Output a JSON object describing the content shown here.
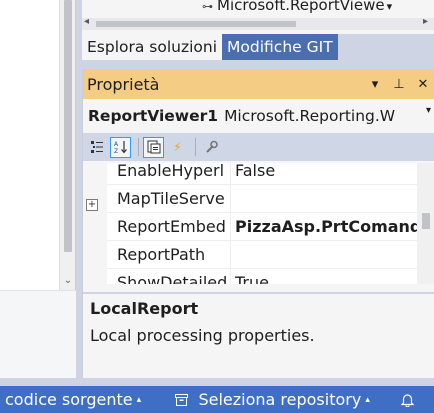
{
  "solution_explorer": {
    "tree_item_label": "Microsoft.ReportViewe",
    "tree_item_icon": "reference-node-icon",
    "tree_item_chevron": "▾"
  },
  "tabs": [
    {
      "label": "Esplora soluzioni",
      "active": true
    },
    {
      "label": "Modifiche GIT",
      "active": false
    }
  ],
  "properties": {
    "title": "Proprietà",
    "buttons": {
      "dropdown": "▾",
      "pin": "⊥",
      "close": "✕"
    },
    "object": {
      "name": "ReportViewer1",
      "type": "Microsoft.Reporting.W"
    },
    "toolbar": [
      "categorized-icon",
      "alphabetical-icon",
      "properties-icon",
      "events-icon",
      "property-pages-icon"
    ],
    "rows": [
      {
        "name": "EnableHyperl",
        "value": "False",
        "bold": false,
        "expandable": false
      },
      {
        "name": "MapTileServe",
        "value": "",
        "bold": false,
        "expandable": true,
        "expander": "+"
      },
      {
        "name": "ReportEmbed",
        "value": "PizzaAsp.PrtComande.rdlc",
        "bold": true,
        "expandable": false
      },
      {
        "name": "ReportPath",
        "value": "",
        "bold": false,
        "expandable": false
      },
      {
        "name": "ShowDetailed",
        "value": "True",
        "bold": false,
        "expandable": false
      }
    ],
    "description": {
      "title": "LocalReport",
      "text": "Local processing properties."
    }
  },
  "statusbar": {
    "source_label": "codice sorgente",
    "repo_label": "Seleziona repository",
    "caret": "▴",
    "repo_icon": "repository-icon",
    "bell_icon": "notification-bell-icon"
  },
  "colors": {
    "title_bar": "#f5cc84",
    "statusbar": "#3f6fc5",
    "active_tab": "#f5f5f5",
    "inactive_tab": "#4b6eaf",
    "toolbar": "#cfd6e5"
  }
}
